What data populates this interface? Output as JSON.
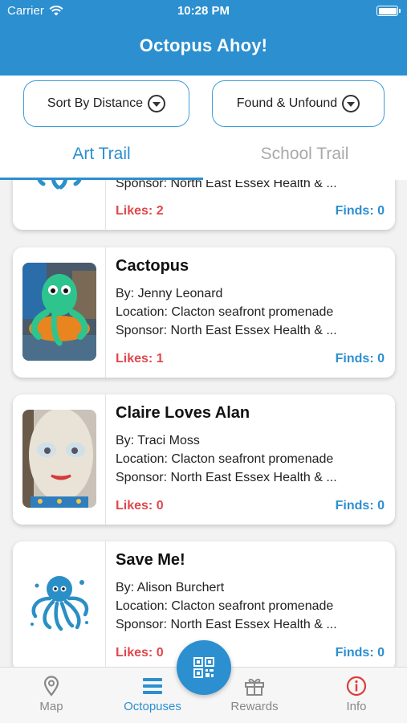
{
  "status_bar": {
    "carrier": "Carrier",
    "time": "10:28 PM"
  },
  "app": {
    "title": "Octopus Ahoy!"
  },
  "filters": {
    "sort_label": "Sort By Distance",
    "found_label": "Found & Unfound"
  },
  "tabs": [
    {
      "label": "Art Trail",
      "active": true
    },
    {
      "label": "School Trail",
      "active": false
    }
  ],
  "octopuses": [
    {
      "name": "",
      "by": "",
      "location": "",
      "sponsor": "Sponsor: North East Essex Health & ...",
      "likes": "Likes: 2",
      "finds": "Finds: 0",
      "image": "octopus-logo"
    },
    {
      "name": "Cactopus",
      "by": "By: Jenny Leonard",
      "location": "Location: Clacton seafront promenade",
      "sponsor": "Sponsor: North East Essex Health & ...",
      "likes": "Likes: 1",
      "finds": "Finds: 0",
      "image": "green-octopus-sculpture"
    },
    {
      "name": "Claire Loves Alan",
      "by": "By: Traci Moss",
      "location": "Location: Clacton seafront promenade",
      "sponsor": "Sponsor: North East Essex Health & ...",
      "likes": "Likes: 0",
      "finds": "Finds: 0",
      "image": "face-sculpture"
    },
    {
      "name": "Save Me!",
      "by": "By: Alison Burchert",
      "location": "Location: Clacton seafront promenade",
      "sponsor": "Sponsor: North East Essex Health & ...",
      "likes": "Likes: 0",
      "finds": "Finds: 0",
      "image": "octopus-logo"
    }
  ],
  "tabbar": {
    "map": "Map",
    "octopuses": "Octopuses",
    "rewards": "Rewards",
    "info": "Info"
  },
  "colors": {
    "primary": "#2b8fd0",
    "likes": "#e0474c",
    "info": "#e0393c"
  }
}
